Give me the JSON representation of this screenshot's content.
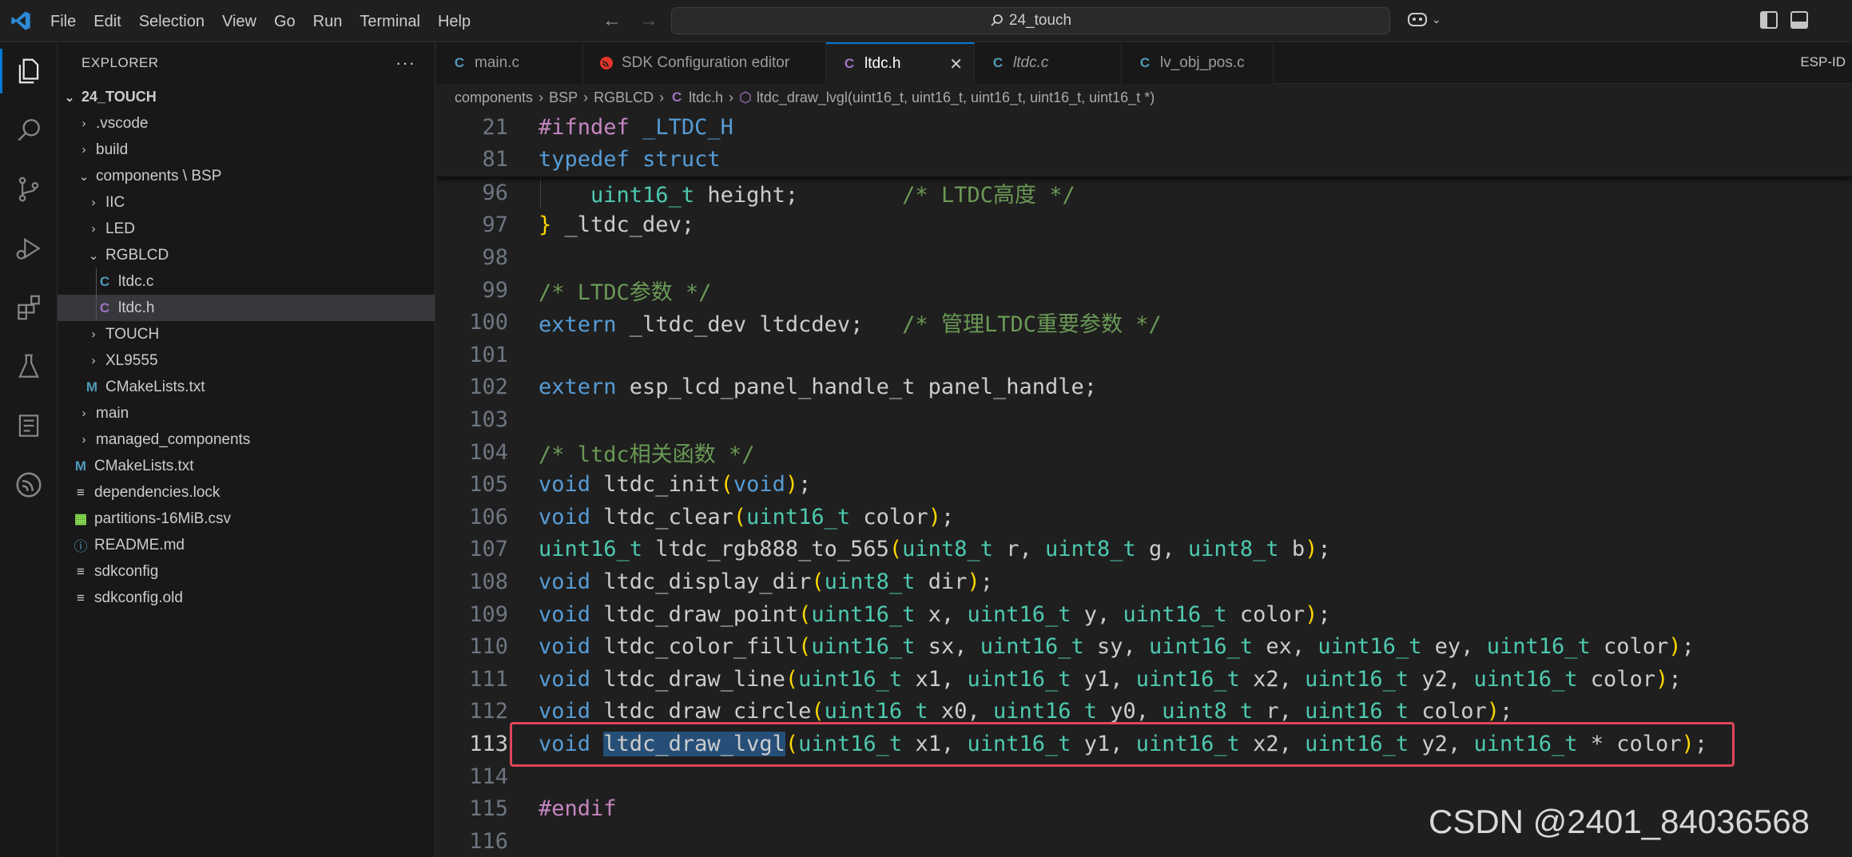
{
  "menu": [
    "File",
    "Edit",
    "Selection",
    "View",
    "Go",
    "Run",
    "Terminal",
    "Help"
  ],
  "search": {
    "text": "24_touch"
  },
  "explorer": {
    "title": "EXPLORER",
    "more": "···",
    "root": "24_TOUCH",
    "items": [
      {
        "label": ".vscode",
        "type": "folder"
      },
      {
        "label": "build",
        "type": "folder"
      },
      {
        "label": "components \\ BSP",
        "type": "folder-open"
      },
      {
        "label": "IIC",
        "type": "folder"
      },
      {
        "label": "LED",
        "type": "folder"
      },
      {
        "label": "RGBLCD",
        "type": "folder-open"
      },
      {
        "label": "ltdc.c",
        "type": "c"
      },
      {
        "label": "ltdc.h",
        "type": "h"
      },
      {
        "label": "TOUCH",
        "type": "folder"
      },
      {
        "label": "XL9555",
        "type": "folder"
      },
      {
        "label": "CMakeLists.txt",
        "type": "m"
      },
      {
        "label": "main",
        "type": "folder"
      },
      {
        "label": "managed_components",
        "type": "folder"
      },
      {
        "label": "CMakeLists.txt",
        "type": "m"
      },
      {
        "label": "dependencies.lock",
        "type": "lock"
      },
      {
        "label": "partitions-16MiB.csv",
        "type": "csv"
      },
      {
        "label": "README.md",
        "type": "info"
      },
      {
        "label": "sdkconfig",
        "type": "cfg"
      },
      {
        "label": "sdkconfig.old",
        "type": "cfg"
      }
    ]
  },
  "tabs": [
    {
      "label": "main.c",
      "icon": "C"
    },
    {
      "label": "SDK Configuration editor",
      "icon": "esp"
    },
    {
      "label": "ltdc.h",
      "icon": "C",
      "close": "✕"
    },
    {
      "label": "ltdc.c",
      "icon": "C"
    },
    {
      "label": "lv_obj_pos.c",
      "icon": "C"
    }
  ],
  "tab_extra": "ESP-ID",
  "breadcrumb": {
    "parts": [
      "components",
      "BSP",
      "RGBLCD",
      "ltdc.h"
    ],
    "symbol": "ltdc_draw_lvgl(uint16_t, uint16_t, uint16_t, uint16_t, uint16_t *)"
  },
  "code": {
    "line_numbers": [
      "21",
      "81",
      "96",
      "97",
      "98",
      "99",
      "100",
      "101",
      "102",
      "103",
      "104",
      "105",
      "106",
      "107",
      "108",
      "109",
      "110",
      "111",
      "112",
      "113",
      "114",
      "115",
      "116"
    ]
  },
  "watermark": "CSDN @2401_84036568"
}
